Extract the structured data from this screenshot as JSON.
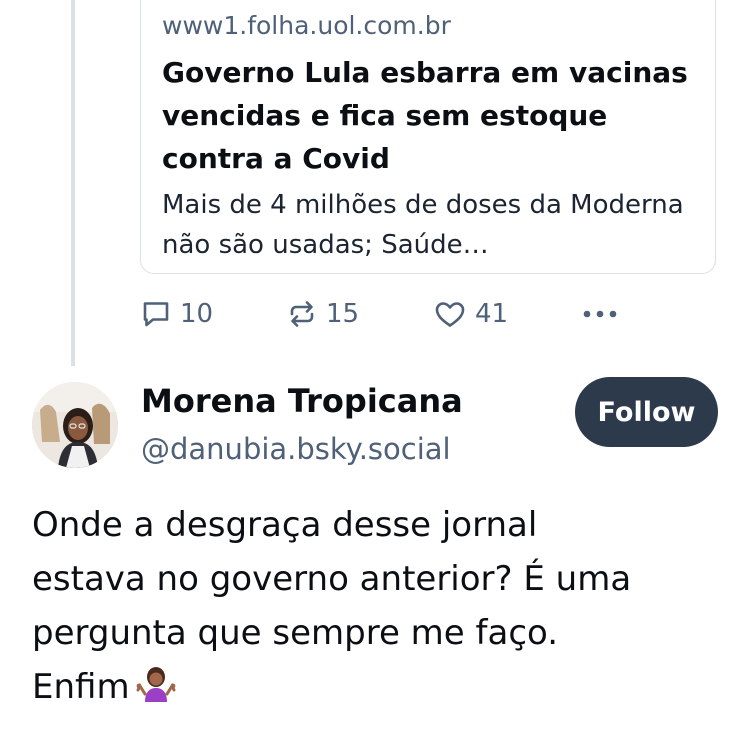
{
  "quoted_post": {
    "link_card": {
      "domain": "www1.folha.uol.com.br",
      "title": "Governo Lula esbarra em vacinas vencidas e fica sem estoque contra a Covid",
      "description": "Mais de 4 milhões de doses da Moderna não são usadas; Saúde…"
    },
    "actions": {
      "reply_count": "10",
      "repost_count": "15",
      "like_count": "41",
      "reply_icon": "comment-icon",
      "repost_icon": "repost-icon",
      "like_icon": "heart-icon",
      "more_icon": "ellipsis-icon"
    }
  },
  "post": {
    "author": {
      "display_name": "Morena Tropicana",
      "handle": "@danubia.bsky.social"
    },
    "follow_label": "Follow",
    "text_lines": [
      "Onde a desgraça desse jornal",
      "estava no governo anterior? É uma",
      "pergunta que sempre me faço.",
      "Enfim"
    ],
    "emoji": "person-shrugging-emoji"
  },
  "colors": {
    "muted_text": "#4f6178",
    "border": "#d9e1e8",
    "follow_bg": "#2c3a4c",
    "emoji_shirt": "#9b3fc7"
  }
}
